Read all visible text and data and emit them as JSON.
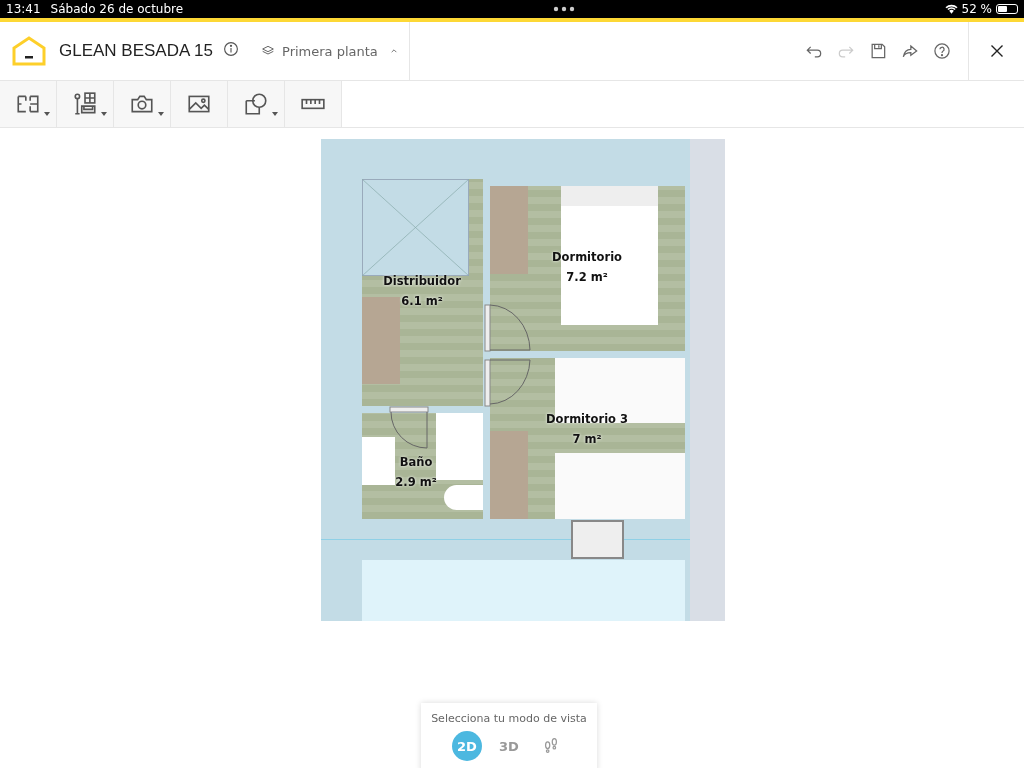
{
  "status_bar": {
    "time": "13:41",
    "date": "Sábado 26 de octubre",
    "battery": "52 %"
  },
  "header": {
    "title": "GLEAN BESADA 15",
    "floor": "Primera planta"
  },
  "header_actions": [
    {
      "kind": "undo",
      "disabled": false
    },
    {
      "kind": "redo",
      "disabled": true
    },
    {
      "kind": "save",
      "disabled": false
    },
    {
      "kind": "share",
      "disabled": false
    },
    {
      "kind": "help",
      "disabled": false
    }
  ],
  "tools": [
    {
      "kind": "walls",
      "dropdown": true
    },
    {
      "kind": "furniture",
      "dropdown": true
    },
    {
      "kind": "camera",
      "dropdown": true
    },
    {
      "kind": "image",
      "dropdown": false
    },
    {
      "kind": "shapes",
      "dropdown": true
    },
    {
      "kind": "ruler",
      "dropdown": false
    }
  ],
  "rooms": [
    {
      "name": "Distribuidor",
      "area": "6.1 m²"
    },
    {
      "name": "Dormitorio",
      "area": "7.2 m²"
    },
    {
      "name": "Dormitorio 3",
      "area": "7 m²"
    },
    {
      "name": "Baño",
      "area": "2.9 m²"
    }
  ],
  "view_mode": {
    "label": "Selecciona tu modo de vista",
    "modes": [
      {
        "kind": "text",
        "label": "2D",
        "selected": true
      },
      {
        "kind": "text",
        "label": "3D",
        "selected": false
      },
      {
        "kind": "walk",
        "selected": false
      }
    ]
  }
}
